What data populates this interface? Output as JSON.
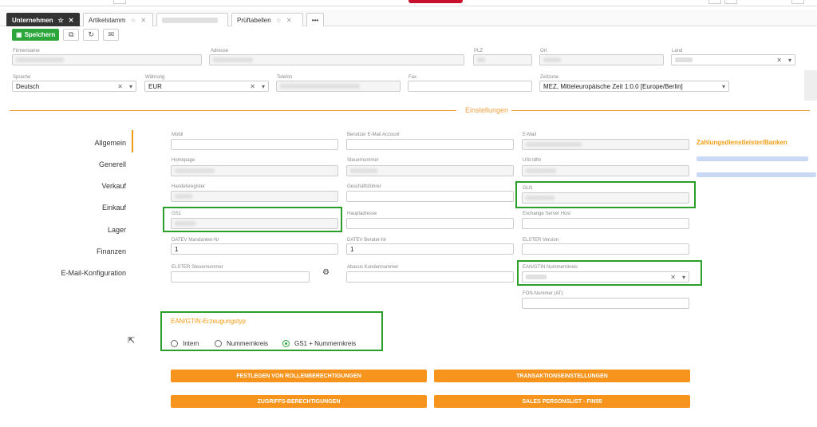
{
  "tabs": [
    {
      "label": "Unternehmen",
      "active": true
    },
    {
      "label": "Artikelstamm",
      "active": false
    },
    {
      "label": "",
      "active": false
    },
    {
      "label": "Prüftabellen",
      "active": false
    },
    {
      "label": "•••",
      "active": false
    }
  ],
  "toolbar": {
    "save_label": "Speichern"
  },
  "company": {
    "firmenname_label": "Firmenname",
    "adresse_label": "Adresse",
    "plz_label": "PLZ",
    "ort_label": "Ort",
    "land_label": "Land",
    "sprache_label": "Sprache",
    "sprache_value": "Deutsch",
    "waehrung_label": "Währung",
    "waehrung_value": "EUR",
    "telefon_label": "Telefon",
    "fax_label": "Fax",
    "zeitzone_label": "Zeitzone",
    "zeitzone_value": "MEZ, Mitteleuropäische Zeit 1:0.0 [Europe/Berlin]"
  },
  "section_title": "Einstellungen",
  "nav": [
    "Allgemein",
    "Generell",
    "Verkauf",
    "Einkauf",
    "Lager",
    "Finanzen",
    "E-Mail-Konfiguration"
  ],
  "fields": {
    "mobil": "Mobil",
    "benutzer_email": "Benutzer E-Mail Account",
    "email": "E-Mail",
    "homepage": "Homepage",
    "steuernummer": "Steuernummer",
    "ust_idnr": "USt-IdNr",
    "handelsregister": "Handelsregister",
    "geschaeftsfuehrer": "Geschäftsführer",
    "gln": "GLN",
    "gs1": "GS1",
    "hauptadresse": "Hauptadresse",
    "exchange": "Exchange Server Host",
    "datev_mandant": "DATEV Mandanten-Nr",
    "datev_mandant_value": "1",
    "datev_berater": "DATEV Berater-Nr",
    "datev_berater_value": "1",
    "elster_version": "ELSTER Version",
    "elster_steuer": "ELSTER Steuernummer",
    "abacus": "Abacus Kundennummer",
    "ean_nummernkreis": "EAN/GTIN Nummernkreis",
    "fon_nummer": "FON-Nummer (AT)"
  },
  "ean_type": {
    "title": "EAN/GTIN-Erzeugungstyp",
    "options": [
      "Intern",
      "Nummernkreis",
      "GS1 + Nummernkreis"
    ],
    "selected": 2
  },
  "buttons": {
    "rollen": "Festlegen von Rollenberechtigungen",
    "transaktion": "Transaktionseinstellungen",
    "zugriff": "Zugriffs-Berechtigungen",
    "sales": "Sales Personslist - FIN55"
  },
  "right_panel": {
    "title": "Zahlungsdienstleister/Banken"
  },
  "colors": {
    "accent": "#f7941d",
    "save": "#2aa63a",
    "highlight": "#2aa02a"
  }
}
